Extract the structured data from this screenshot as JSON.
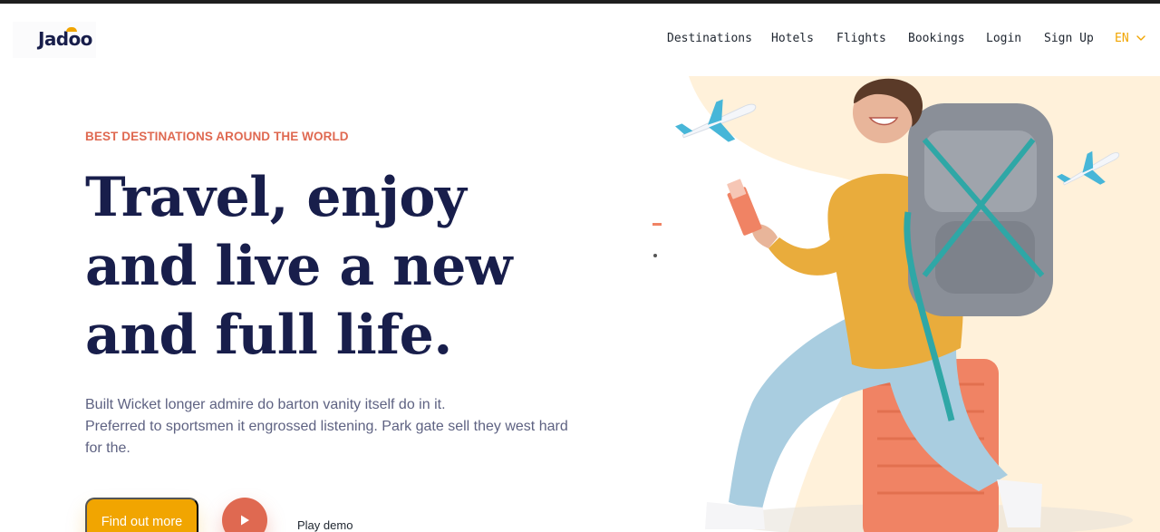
{
  "header": {
    "logo": "Jadoo",
    "nav": [
      {
        "label": "Destinations"
      },
      {
        "label": "Hotels"
      },
      {
        "label": "Flights"
      },
      {
        "label": "Bookings"
      },
      {
        "label": "Login"
      },
      {
        "label": "Sign Up"
      }
    ],
    "language": "EN",
    "language_icon": "chevron-down-icon"
  },
  "hero": {
    "eyebrow": "BEST DESTINATIONS AROUND THE WORLD",
    "headline_lines": [
      "Travel, enjoy",
      "and live a new",
      "and full life."
    ],
    "description_lines": [
      "Built Wicket longer admire do barton vanity itself do in it.",
      "Preferred to sportsmen it engrossed listening. Park gate sell they west hard",
      "for the."
    ],
    "primary_button": "Find out more",
    "play_button_icon": "play-icon",
    "play_label": "Play demo",
    "image_icons": [
      "airplane-icon",
      "airplane-icon",
      "backpack-icon",
      "suitcase-icon",
      "passport-icon"
    ]
  },
  "colors": {
    "primary": "#f1a501",
    "accent": "#df6951",
    "heading": "#181e4b",
    "text": "#5e6282",
    "blob": "#fff1da"
  }
}
